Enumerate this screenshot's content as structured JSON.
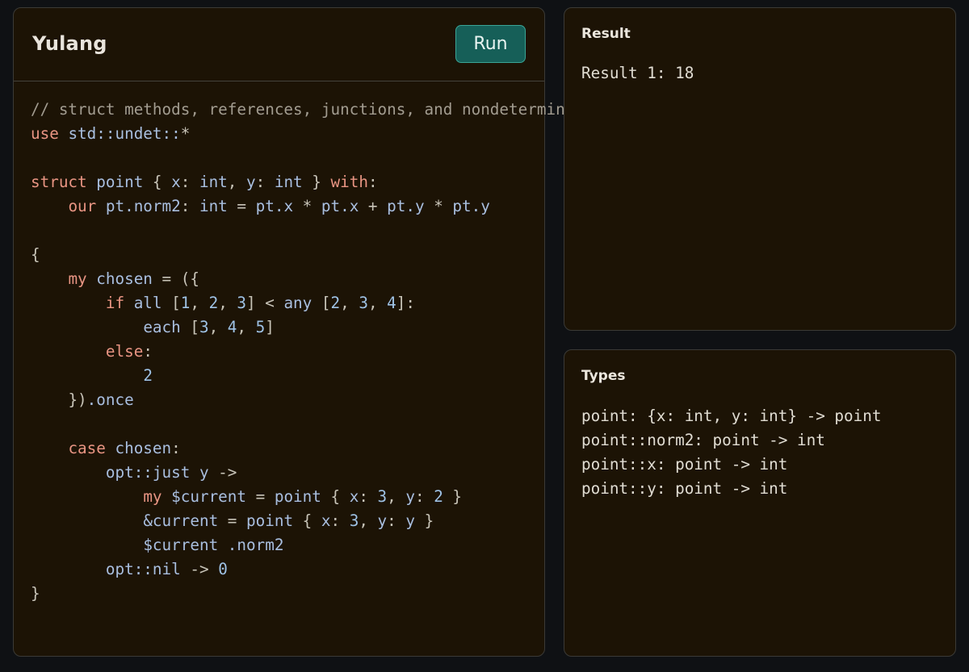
{
  "app": {
    "title": "Yulang",
    "run_label": "Run"
  },
  "code_lines": [
    [
      {
        "t": "// struct methods, references, junctions, and nondeterminism",
        "c": "comment"
      }
    ],
    [
      {
        "t": "use",
        "c": "keyword"
      },
      {
        "t": " ",
        "c": "plain"
      },
      {
        "t": "std::undet::",
        "c": "path"
      },
      {
        "t": "*",
        "c": "op"
      }
    ],
    [],
    [
      {
        "t": "struct",
        "c": "keyword"
      },
      {
        "t": " ",
        "c": "plain"
      },
      {
        "t": "point",
        "c": "ident"
      },
      {
        "t": " { ",
        "c": "punct"
      },
      {
        "t": "x",
        "c": "ident"
      },
      {
        "t": ": ",
        "c": "punct"
      },
      {
        "t": "int",
        "c": "type"
      },
      {
        "t": ", ",
        "c": "punct"
      },
      {
        "t": "y",
        "c": "ident"
      },
      {
        "t": ": ",
        "c": "punct"
      },
      {
        "t": "int",
        "c": "type"
      },
      {
        "t": " } ",
        "c": "punct"
      },
      {
        "t": "with",
        "c": "keyword"
      },
      {
        "t": ":",
        "c": "punct"
      }
    ],
    [
      {
        "t": "    ",
        "c": "plain"
      },
      {
        "t": "our",
        "c": "keyword"
      },
      {
        "t": " ",
        "c": "plain"
      },
      {
        "t": "pt.norm2",
        "c": "ident"
      },
      {
        "t": ": ",
        "c": "punct"
      },
      {
        "t": "int",
        "c": "type"
      },
      {
        "t": " = ",
        "c": "op"
      },
      {
        "t": "pt.x",
        "c": "ident"
      },
      {
        "t": " * ",
        "c": "op"
      },
      {
        "t": "pt.x",
        "c": "ident"
      },
      {
        "t": " + ",
        "c": "op"
      },
      {
        "t": "pt.y",
        "c": "ident"
      },
      {
        "t": " * ",
        "c": "op"
      },
      {
        "t": "pt.y",
        "c": "ident"
      }
    ],
    [],
    [
      {
        "t": "{",
        "c": "punct"
      }
    ],
    [
      {
        "t": "    ",
        "c": "plain"
      },
      {
        "t": "my",
        "c": "keyword"
      },
      {
        "t": " ",
        "c": "plain"
      },
      {
        "t": "chosen",
        "c": "ident"
      },
      {
        "t": " = ({",
        "c": "punct"
      }
    ],
    [
      {
        "t": "        ",
        "c": "plain"
      },
      {
        "t": "if",
        "c": "keyword"
      },
      {
        "t": " ",
        "c": "plain"
      },
      {
        "t": "all",
        "c": "ident"
      },
      {
        "t": " [",
        "c": "punct"
      },
      {
        "t": "1",
        "c": "number"
      },
      {
        "t": ", ",
        "c": "punct"
      },
      {
        "t": "2",
        "c": "number"
      },
      {
        "t": ", ",
        "c": "punct"
      },
      {
        "t": "3",
        "c": "number"
      },
      {
        "t": "] < ",
        "c": "punct"
      },
      {
        "t": "any",
        "c": "ident"
      },
      {
        "t": " [",
        "c": "punct"
      },
      {
        "t": "2",
        "c": "number"
      },
      {
        "t": ", ",
        "c": "punct"
      },
      {
        "t": "3",
        "c": "number"
      },
      {
        "t": ", ",
        "c": "punct"
      },
      {
        "t": "4",
        "c": "number"
      },
      {
        "t": "]:",
        "c": "punct"
      }
    ],
    [
      {
        "t": "            ",
        "c": "plain"
      },
      {
        "t": "each",
        "c": "ident"
      },
      {
        "t": " [",
        "c": "punct"
      },
      {
        "t": "3",
        "c": "number"
      },
      {
        "t": ", ",
        "c": "punct"
      },
      {
        "t": "4",
        "c": "number"
      },
      {
        "t": ", ",
        "c": "punct"
      },
      {
        "t": "5",
        "c": "number"
      },
      {
        "t": "]",
        "c": "punct"
      }
    ],
    [
      {
        "t": "        ",
        "c": "plain"
      },
      {
        "t": "else",
        "c": "keyword"
      },
      {
        "t": ":",
        "c": "punct"
      }
    ],
    [
      {
        "t": "            ",
        "c": "plain"
      },
      {
        "t": "2",
        "c": "number"
      }
    ],
    [
      {
        "t": "    ",
        "c": "plain"
      },
      {
        "t": "})",
        "c": "punct"
      },
      {
        "t": ".once",
        "c": "ident"
      }
    ],
    [],
    [
      {
        "t": "    ",
        "c": "plain"
      },
      {
        "t": "case",
        "c": "keyword"
      },
      {
        "t": " ",
        "c": "plain"
      },
      {
        "t": "chosen",
        "c": "ident"
      },
      {
        "t": ":",
        "c": "punct"
      }
    ],
    [
      {
        "t": "        ",
        "c": "plain"
      },
      {
        "t": "opt::just",
        "c": "path"
      },
      {
        "t": " ",
        "c": "plain"
      },
      {
        "t": "y",
        "c": "ident"
      },
      {
        "t": " ->",
        "c": "op"
      }
    ],
    [
      {
        "t": "            ",
        "c": "plain"
      },
      {
        "t": "my",
        "c": "keyword"
      },
      {
        "t": " ",
        "c": "plain"
      },
      {
        "t": "$current",
        "c": "ident"
      },
      {
        "t": " = ",
        "c": "op"
      },
      {
        "t": "point",
        "c": "ident"
      },
      {
        "t": " { ",
        "c": "punct"
      },
      {
        "t": "x",
        "c": "ident"
      },
      {
        "t": ": ",
        "c": "punct"
      },
      {
        "t": "3",
        "c": "number"
      },
      {
        "t": ", ",
        "c": "punct"
      },
      {
        "t": "y",
        "c": "ident"
      },
      {
        "t": ": ",
        "c": "punct"
      },
      {
        "t": "2",
        "c": "number"
      },
      {
        "t": " }",
        "c": "punct"
      }
    ],
    [
      {
        "t": "            ",
        "c": "plain"
      },
      {
        "t": "&current",
        "c": "ident"
      },
      {
        "t": " = ",
        "c": "op"
      },
      {
        "t": "point",
        "c": "ident"
      },
      {
        "t": " { ",
        "c": "punct"
      },
      {
        "t": "x",
        "c": "ident"
      },
      {
        "t": ": ",
        "c": "punct"
      },
      {
        "t": "3",
        "c": "number"
      },
      {
        "t": ", ",
        "c": "punct"
      },
      {
        "t": "y",
        "c": "ident"
      },
      {
        "t": ": ",
        "c": "punct"
      },
      {
        "t": "y",
        "c": "ident"
      },
      {
        "t": " }",
        "c": "punct"
      }
    ],
    [
      {
        "t": "            ",
        "c": "plain"
      },
      {
        "t": "$current",
        "c": "ident"
      },
      {
        "t": " ",
        "c": "plain"
      },
      {
        "t": ".norm2",
        "c": "ident"
      }
    ],
    [
      {
        "t": "        ",
        "c": "plain"
      },
      {
        "t": "opt::nil",
        "c": "path"
      },
      {
        "t": " -> ",
        "c": "op"
      },
      {
        "t": "0",
        "c": "number"
      }
    ],
    [
      {
        "t": "}",
        "c": "punct"
      }
    ]
  ],
  "result": {
    "title": "Result",
    "text": "Result 1: 18"
  },
  "types": {
    "title": "Types",
    "lines": [
      "point: {x: int, y: int} -> point",
      "point::norm2: point -> int",
      "point::x: point -> int",
      "point::y: point -> int"
    ]
  },
  "colors": {
    "background": "#0f1114",
    "panel": "#1c1305",
    "run_button": "#165f58",
    "comment": "#a29c90",
    "keyword": "#e99583",
    "identifier": "#a9bfe0",
    "number": "#9fc3e6"
  }
}
